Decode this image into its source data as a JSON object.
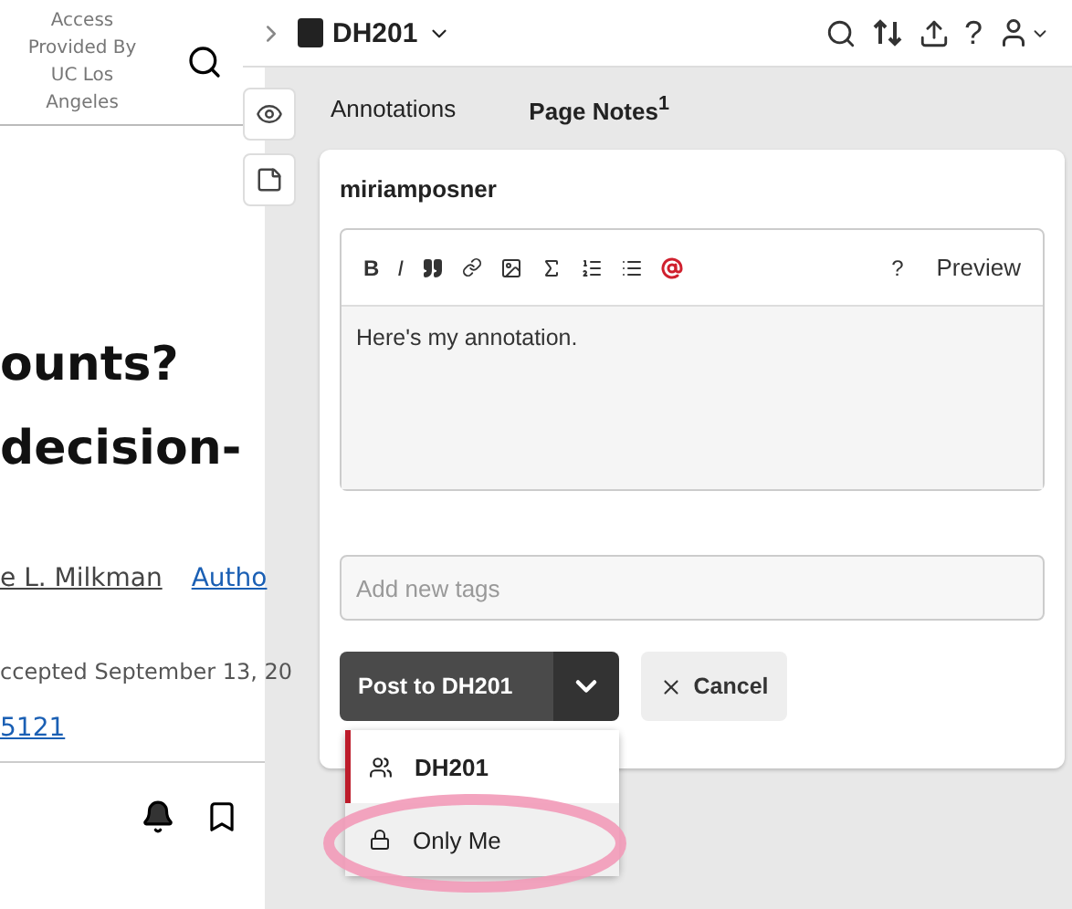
{
  "article": {
    "access_lines": [
      "Access",
      "Provided By",
      "UC Los",
      "Angeles"
    ],
    "title_lines": [
      "ounts?",
      "decision-"
    ],
    "author": "e L. Milkman",
    "author_link": "Autho",
    "dates": "ccepted September 13, 20",
    "doi": "5121"
  },
  "top_bar": {
    "group": "DH201",
    "help": "?"
  },
  "tabs": [
    {
      "label": "Annotations",
      "selected": false
    },
    {
      "label": "Page Notes",
      "selected": true,
      "count": "1"
    }
  ],
  "annotation": {
    "user": "miriamposner",
    "toolbar": {
      "bold": "B",
      "italic": "I",
      "help": "?",
      "preview": "Preview"
    },
    "text": "Here's my annotation.",
    "tags": {
      "placeholder": "Add new tags"
    },
    "post_label": "Post to DH201",
    "cancel_label": "Cancel"
  },
  "post_menu": [
    {
      "label": "DH201",
      "kind": "group",
      "selected": true,
      "highlighted": false
    },
    {
      "label": "Only Me",
      "kind": "private",
      "selected": false,
      "highlighted": true
    }
  ]
}
